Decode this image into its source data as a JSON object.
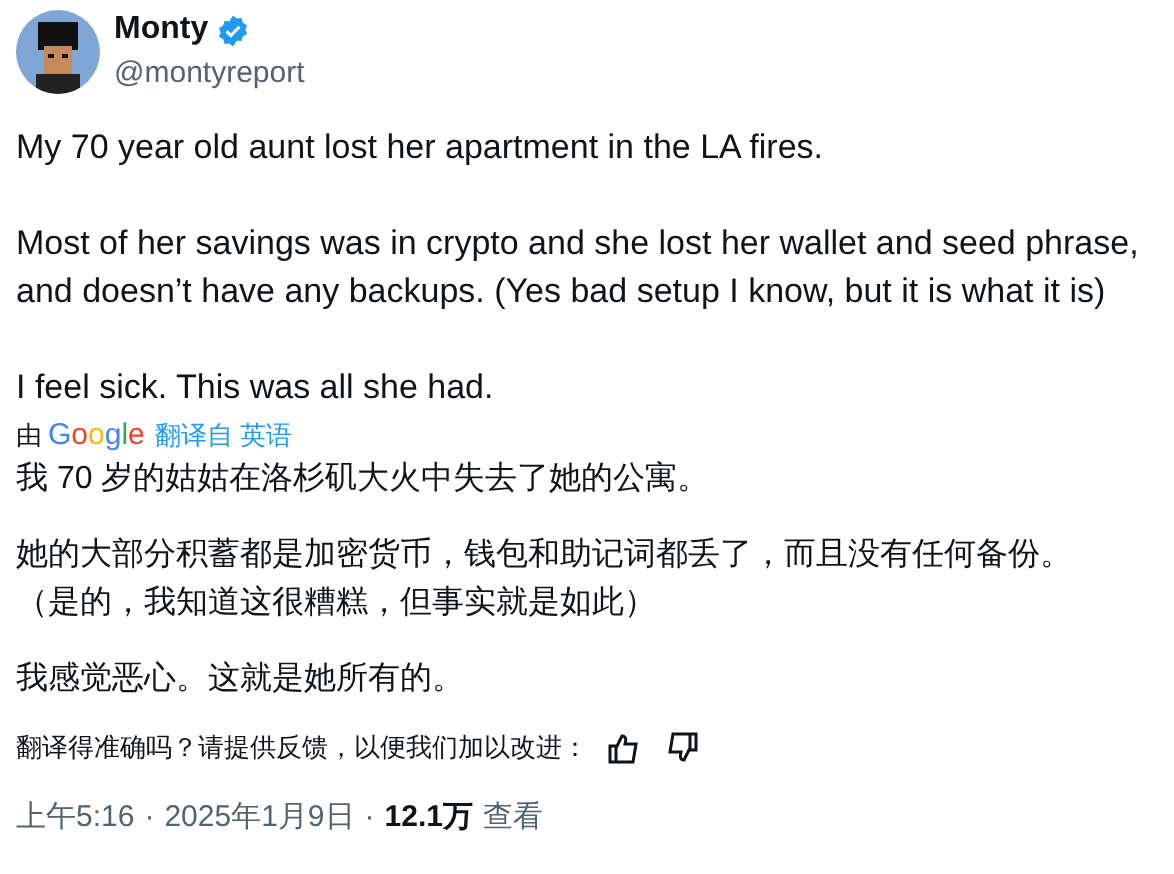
{
  "author": {
    "name": "Monty",
    "verified": true,
    "handle": "@montyreport"
  },
  "paragraphs": [
    "My 70 year old aunt lost her apartment in the LA fires.",
    "Most of her savings was in crypto and she lost her wallet and seed phrase, and doesn’t have any backups. (Yes bad setup I know, but it is what it is)",
    "I feel sick. This was all she had."
  ],
  "translation": {
    "by": "由",
    "provider": "Google",
    "source": "翻译自 英语",
    "paragraphs": [
      "我 70 岁的姑姑在洛杉矶大火中失去了她的公寓。",
      "她的大部分积蓄都是加密货币，钱包和助记词都丢了，而且没有任何备份。（是的，我知道这很糟糕，但事实就是如此）",
      "我感觉恶心。这就是她所有的。"
    ],
    "feedback": "翻译得准确吗？请提供反馈，以便我们加以改进："
  },
  "meta": {
    "time": "上午5:16",
    "date": "2025年1月9日",
    "views": "12.1万",
    "views_label": "查看",
    "separators": [
      "·",
      "·"
    ]
  }
}
